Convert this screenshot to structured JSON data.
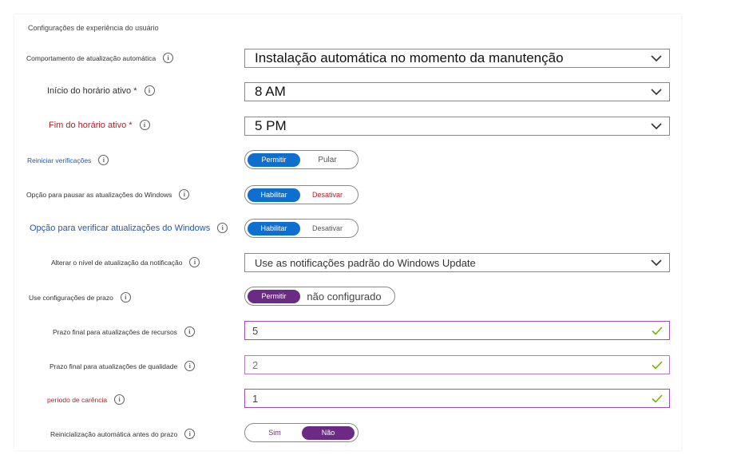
{
  "section_title": "Configurações de experiência do usuário",
  "rows": {
    "auto_update": {
      "label": "Comportamento de atualização automática",
      "value": "Instalação automática no momento da manutenção"
    },
    "active_start": {
      "label": "Início do horário ativo *",
      "value": "8 AM"
    },
    "active_end": {
      "label": "Fim do horário ativo *",
      "value": "5 PM"
    },
    "restart_checks": {
      "label": "Reiniciar verificações",
      "options": [
        "Permitir",
        "Pular"
      ],
      "selected": "Permitir"
    },
    "pause_updates": {
      "label": "Opção para pausar as atualizações do Windows",
      "options": [
        "Habilitar",
        "Desativar"
      ],
      "selected": "Habilitar"
    },
    "check_updates": {
      "label": "Opção para verificar atualizações do Windows",
      "options": [
        "Habilitar",
        "Desativar"
      ],
      "selected": "Habilitar"
    },
    "notification_level": {
      "label": "Alterar o nível de atualização da notificação",
      "value": "Use as notificações padrão do Windows Update"
    },
    "deadline_settings": {
      "label": "Use configurações de prazo",
      "options": [
        "Permitir",
        "não configurado"
      ],
      "selected": "Permitir"
    },
    "feature_deadline": {
      "label": "Prazo final para atualizações de recursos",
      "value": "5"
    },
    "quality_deadline": {
      "label": "Prazo final para atualizações de qualidade",
      "value": "2"
    },
    "grace_period": {
      "label": "período de carência",
      "value": "1"
    },
    "auto_restart": {
      "label": "Reinicialização automática antes do prazo",
      "options": [
        "Sim",
        "Não"
      ],
      "selected": "Não"
    }
  },
  "info_glyph": "i",
  "colors": {
    "accent_blue": "#0f6fcf",
    "accent_purple": "#6b2a84",
    "valid_check": "#6bb700",
    "label_blue": "#2b579a",
    "label_red": "#a4262c"
  }
}
